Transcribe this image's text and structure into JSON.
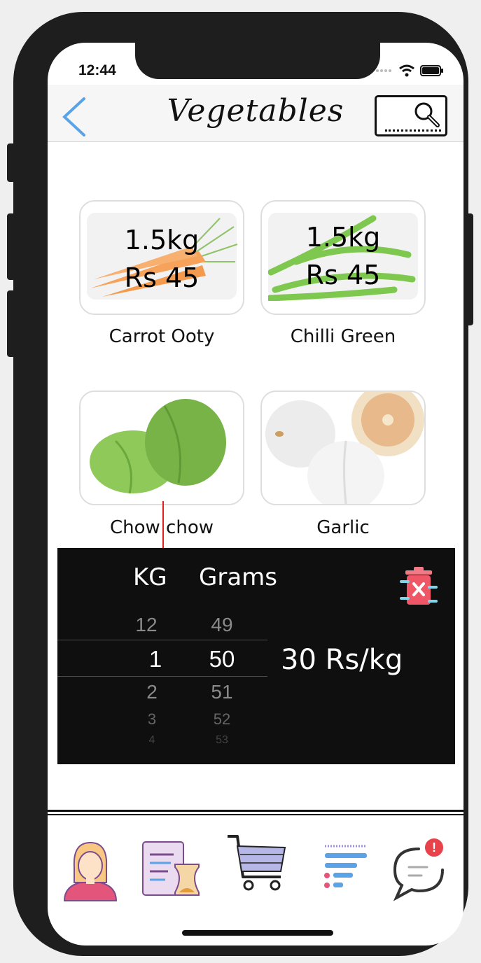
{
  "status": {
    "time": "12:44"
  },
  "nav": {
    "title": "Vegetables"
  },
  "products": [
    {
      "name": "Carrot Ooty",
      "weight": "1.5kg",
      "price": "Rs 45"
    },
    {
      "name": "Chilli Green",
      "weight": "1.5kg",
      "price": "Rs 45"
    },
    {
      "name": "Chow chow"
    },
    {
      "name": "Garlic"
    }
  ],
  "picker": {
    "kg_label": "KG",
    "grams_label": "Grams",
    "kg_values": [
      "12",
      "1",
      "2",
      "3",
      "4"
    ],
    "gram_values": [
      "49",
      "50",
      "51",
      "52",
      "53"
    ],
    "rate": "30 Rs/kg"
  },
  "tabbar": {
    "items": [
      "profile-icon",
      "order-history-icon",
      "cart-icon",
      "list-icon",
      "chat-icon"
    ],
    "chat_badge": "!"
  },
  "colors": {
    "accent_blue": "#5aa3e6",
    "badge_red": "#e8424a",
    "panel_bg": "#0f0f0f"
  }
}
